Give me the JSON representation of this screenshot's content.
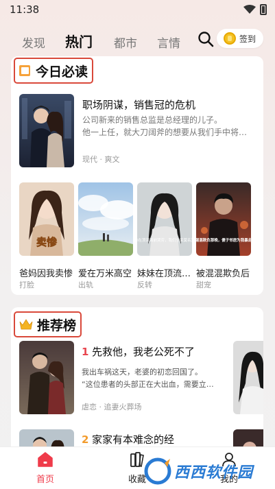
{
  "status_bar": {
    "time": "11:38"
  },
  "top_tabs": [
    {
      "label": "发现",
      "active": false
    },
    {
      "label": "热门",
      "active": true
    },
    {
      "label": "都市",
      "active": false
    },
    {
      "label": "言情",
      "active": false
    }
  ],
  "signin": {
    "label": "签到"
  },
  "today_section": {
    "title": "今日必读",
    "featured": {
      "title": "职场阴谋，销售冠的危机",
      "desc_line1": "公司新来的销售总监是总经理的儿子。",
      "desc_line2": "他一上任，就大刀阔斧的想要从我们手中将客户抢走",
      "tags": "现代 · 爽文"
    },
    "grid": [
      {
        "title": "爸妈因我卖惨",
        "tag": "打脸",
        "cover_text": "卖惨"
      },
      {
        "title": "爱在万米高空",
        "tag": "出轨",
        "cover_text": ""
      },
      {
        "title": "妹妹在顶流面前",
        "tag": "反转",
        "cover_text": "妹妹在顶流面前哭穷，我们全家莫名其妙"
      },
      {
        "title": "被混混欺负后",
        "tag": "甜宠",
        "cover_text": "被混混欺负那晚，傻子邻居为我暴走了"
      }
    ]
  },
  "rank_section": {
    "title": "推荐榜",
    "items": [
      {
        "rank": "1",
        "title": "先救他，我老公死不了",
        "desc_line1": "我出车祸这天，老婆的初恋回国了。",
        "desc_line2": "“这位患者的头部正在大出血，需要立即手术”",
        "tags": "虐恋 · 追妻火葬场",
        "rank_color": "#e8464f"
      },
      {
        "rank": "2",
        "title": "家家有本难念的经",
        "rank_color": "#f29b2c"
      }
    ]
  },
  "bottom_nav": [
    {
      "label": "首页",
      "active": true
    },
    {
      "label": "收藏",
      "active": false
    },
    {
      "label": "我的",
      "active": false
    }
  ],
  "watermark": {
    "text": "西西软件园"
  },
  "colors": {
    "accent_red": "#ef3b4a",
    "highlight_border": "#d9483a"
  }
}
